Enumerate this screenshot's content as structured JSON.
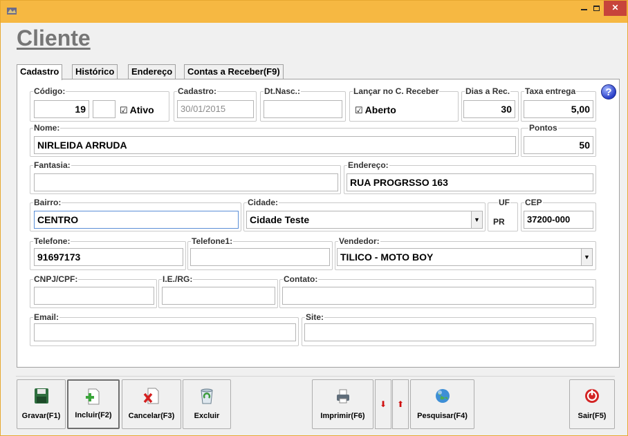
{
  "window": {
    "minimize": "",
    "maximize": "",
    "close": "✕"
  },
  "heading": "Cliente",
  "tabs": [
    "Cadastro",
    "Histórico",
    "Endereço",
    "Contas a Receber(F9)"
  ],
  "help": "?",
  "form": {
    "codigo": {
      "label": "Código:",
      "value": "19",
      "extra": ""
    },
    "ativo": {
      "label": "Ativo",
      "checked": true
    },
    "cadastro": {
      "label": "Cadastro:",
      "value": "30/01/2015"
    },
    "dtnasc": {
      "label": "Dt.Nasc.:",
      "value": ""
    },
    "lancar": {
      "label": "Lançar no C. Receber",
      "checkbox": "Aberto",
      "checked": true
    },
    "dias": {
      "label": "Dias a Rec.",
      "value": "30"
    },
    "taxa": {
      "label": "Taxa entrega",
      "value": "5,00"
    },
    "nome": {
      "label": "Nome:",
      "value": "NIRLEIDA  ARRUDA"
    },
    "pontos": {
      "label": "Pontos",
      "value": "50"
    },
    "fantasia": {
      "label": "Fantasia:",
      "value": ""
    },
    "endereco": {
      "label": "Endereço:",
      "value": "RUA PROGRSSO 163"
    },
    "bairro": {
      "label": "Bairro:",
      "value": "CENTRO"
    },
    "cidade": {
      "label": "Cidade:",
      "value": "Cidade Teste"
    },
    "uf": {
      "label": "UF",
      "value": "PR"
    },
    "cep": {
      "label": "CEP",
      "value": "37200-000"
    },
    "telefone": {
      "label": "Telefone:",
      "value": "91697173"
    },
    "telefone1": {
      "label": "Telefone1:",
      "value": ""
    },
    "vendedor": {
      "label": "Vendedor:",
      "value": "TILICO - MOTO BOY"
    },
    "cnpj": {
      "label": "CNPJ/CPF:",
      "value": ""
    },
    "ie": {
      "label": "I.E./RG:",
      "value": ""
    },
    "contato": {
      "label": "Contato:",
      "value": ""
    },
    "email": {
      "label": "Email:",
      "value": ""
    },
    "site": {
      "label": "Site:",
      "value": ""
    }
  },
  "toolbar": {
    "gravar": "Gravar(F1)",
    "incluir": "Incluir(F2)",
    "cancelar": "Cancelar(F3)",
    "excluir": "Excluir",
    "imprimir": "Imprimir(F6)",
    "down": "⬇",
    "up": "⬆",
    "pesquisar": "Pesquisar(F4)",
    "sair": "Sair(F5)"
  },
  "icons": {
    "app": "app-icon",
    "help": "help-icon",
    "gravar": "save-disk-icon",
    "incluir": "add-document-icon",
    "cancelar": "cancel-document-icon",
    "excluir": "recycle-bin-icon",
    "imprimir": "printer-icon",
    "pesquisar": "search-globe-icon",
    "sair": "exit-icon"
  }
}
